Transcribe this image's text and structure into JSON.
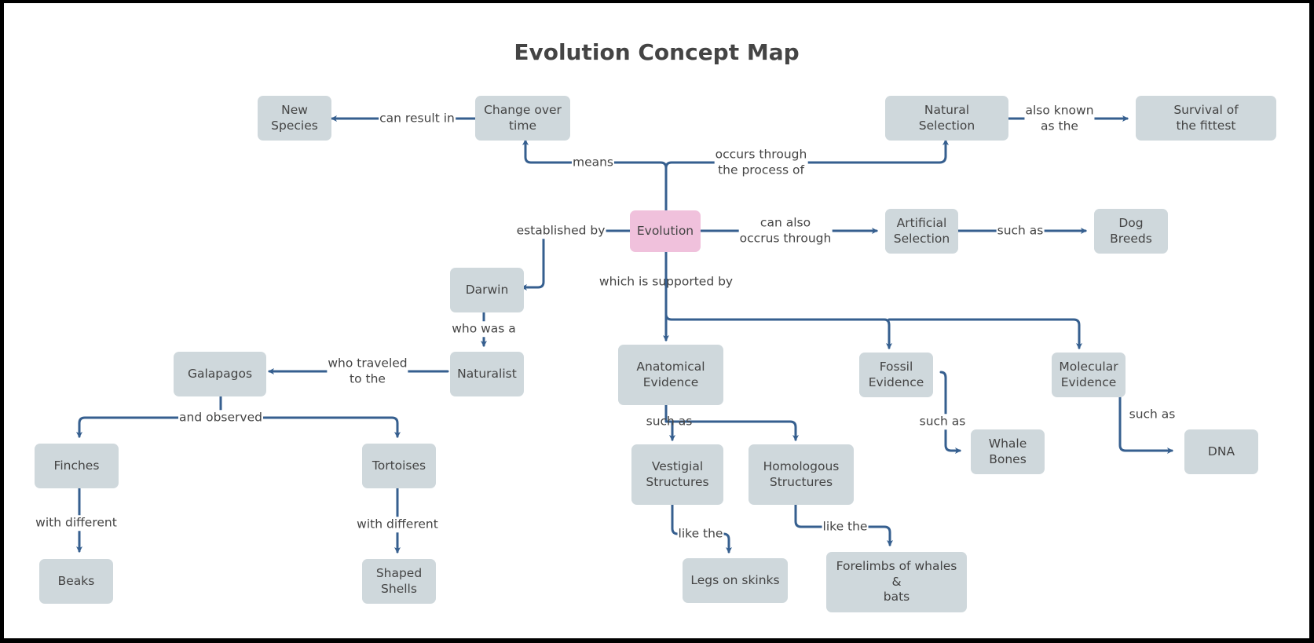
{
  "title": "Evolution Concept Map",
  "colors": {
    "node_fill": "#cfd8dc",
    "root_fill": "#f0c1dc",
    "edge": "#365f8f",
    "text": "#444444"
  },
  "nodes": {
    "evolution": "Evolution",
    "change_over_time": "Change over\ntime",
    "new_species": "New\nSpecies",
    "natural_selection": "Natural\nSelection",
    "survival_fittest": "Survival of\nthe fittest",
    "artificial_selection": "Artificial\nSelection",
    "dog_breeds": "Dog\nBreeds",
    "darwin": "Darwin",
    "naturalist": "Naturalist",
    "galapagos": "Galapagos",
    "finches": "Finches",
    "tortoises": "Tortoises",
    "beaks": "Beaks",
    "shaped_shells": "Shaped\nShells",
    "anatomical_evidence": "Anatomical\nEvidence",
    "fossil_evidence": "Fossil\nEvidence",
    "molecular_evidence": "Molecular\nEvidence",
    "vestigial_structures": "Vestigial\nStructures",
    "homologous_structures": "Homologous\nStructures",
    "legs_on_skinks": "Legs on skinks",
    "forelimbs": "Forelimbs of whales\n&\nbats",
    "whale_bones": "Whale\nBones",
    "dna": "DNA"
  },
  "edge_labels": {
    "means": "means",
    "can_result_in": "can result in",
    "occurs_through": "occurs through\nthe process of",
    "also_known_as": "also known\nas the",
    "can_also_occur": "can also\noccrus through",
    "such_as_dog": "such as",
    "established_by": "established by",
    "who_was_a": "who was a",
    "who_traveled": "who traveled\nto the",
    "and_observed": "and observed",
    "with_different_finches": "with different",
    "with_different_tortoises": "with different",
    "supported_by": "which is supported by",
    "such_as_anatomical": "such as",
    "like_the_vestigial": "like the",
    "like_the_homologous": "like the",
    "such_as_fossil": "such as",
    "such_as_molecular": "such as"
  }
}
